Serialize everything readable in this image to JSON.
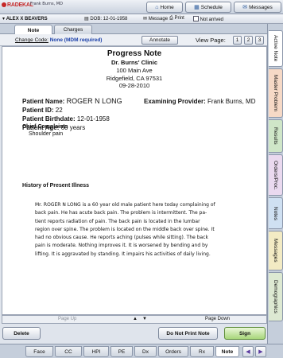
{
  "app": {
    "logo": "RADEKAL",
    "provider": "Frank Burns, MD",
    "nav": {
      "home": "Home",
      "schedule": "Schedule",
      "messages": "Messages"
    }
  },
  "patient_bar": {
    "name": "ALEX X BEAVERS",
    "dob": "DOB: 12-01-1958",
    "message": "Message",
    "print": "Print",
    "status": "Not arrived"
  },
  "tabs": {
    "note": "Note",
    "charges": "Charges"
  },
  "toolbar": {
    "change_code_label": "Change Code:",
    "change_code_value": "None (MDM required)",
    "annotate": "Annotate",
    "view_page": "View Page:",
    "pages": [
      "1",
      "2",
      "3"
    ]
  },
  "note": {
    "title": "Progress Note",
    "clinic": "Dr. Burns' Clinic",
    "address1": "100 Main Ave",
    "address2": "Ridgefield, CA 97531",
    "date": "09-28-2010",
    "patient_name_label": "Patient Name:",
    "patient_name": "ROGER N LONG",
    "patient_id_label": "Patient ID:",
    "patient_id": "22",
    "patient_birthdate_label": "Patient Birthdate:",
    "patient_birthdate": "12-01-1958",
    "patient_age_label": "Patient Age:",
    "patient_age": "60 years",
    "provider_label": "Examining Provider:",
    "provider": "Frank Burns, MD",
    "chief_complaints_label": "Chief Complaints",
    "chief_complaints": "Shoulder pain",
    "hpi_label": "History of Present Illness",
    "hpi_lines": [
      "Mr. ROGER N LONG is a 60 year old male patient here today complaining of",
      "back pain. He has acute back pain. The problem is intermittent. The pa-",
      "tient reports radiation of pain. The back pain is located in the lumbar",
      "region over spine. The problem is located on the middle back over spine. It",
      "had no obvious cause. He reports aching (pulses while sitting). The back",
      "pain is moderate. Nothing improves it. It is worsened by bending and by",
      "lifting. It is aggravated by standing. It impairs his activities of daily living."
    ]
  },
  "pager": {
    "page_up": "Page Up",
    "page_down": "Page Down"
  },
  "actions": {
    "delete": "Delete",
    "do_not_print": "Do Not Print Note",
    "sign": "Sign"
  },
  "bottom_tabs": [
    "Face",
    "CC",
    "HPI",
    "PE",
    "Dx",
    "Orders",
    "Rx",
    "Note"
  ],
  "side_tabs": [
    "Active Note",
    "Master Problem",
    "Results",
    "Orders/Proc.",
    "Notes",
    "Messages",
    "Demographics"
  ],
  "colors": {
    "sign_button": "#a8d67a",
    "logo_red": "#c62828",
    "code_link": "#1a3fa8"
  }
}
